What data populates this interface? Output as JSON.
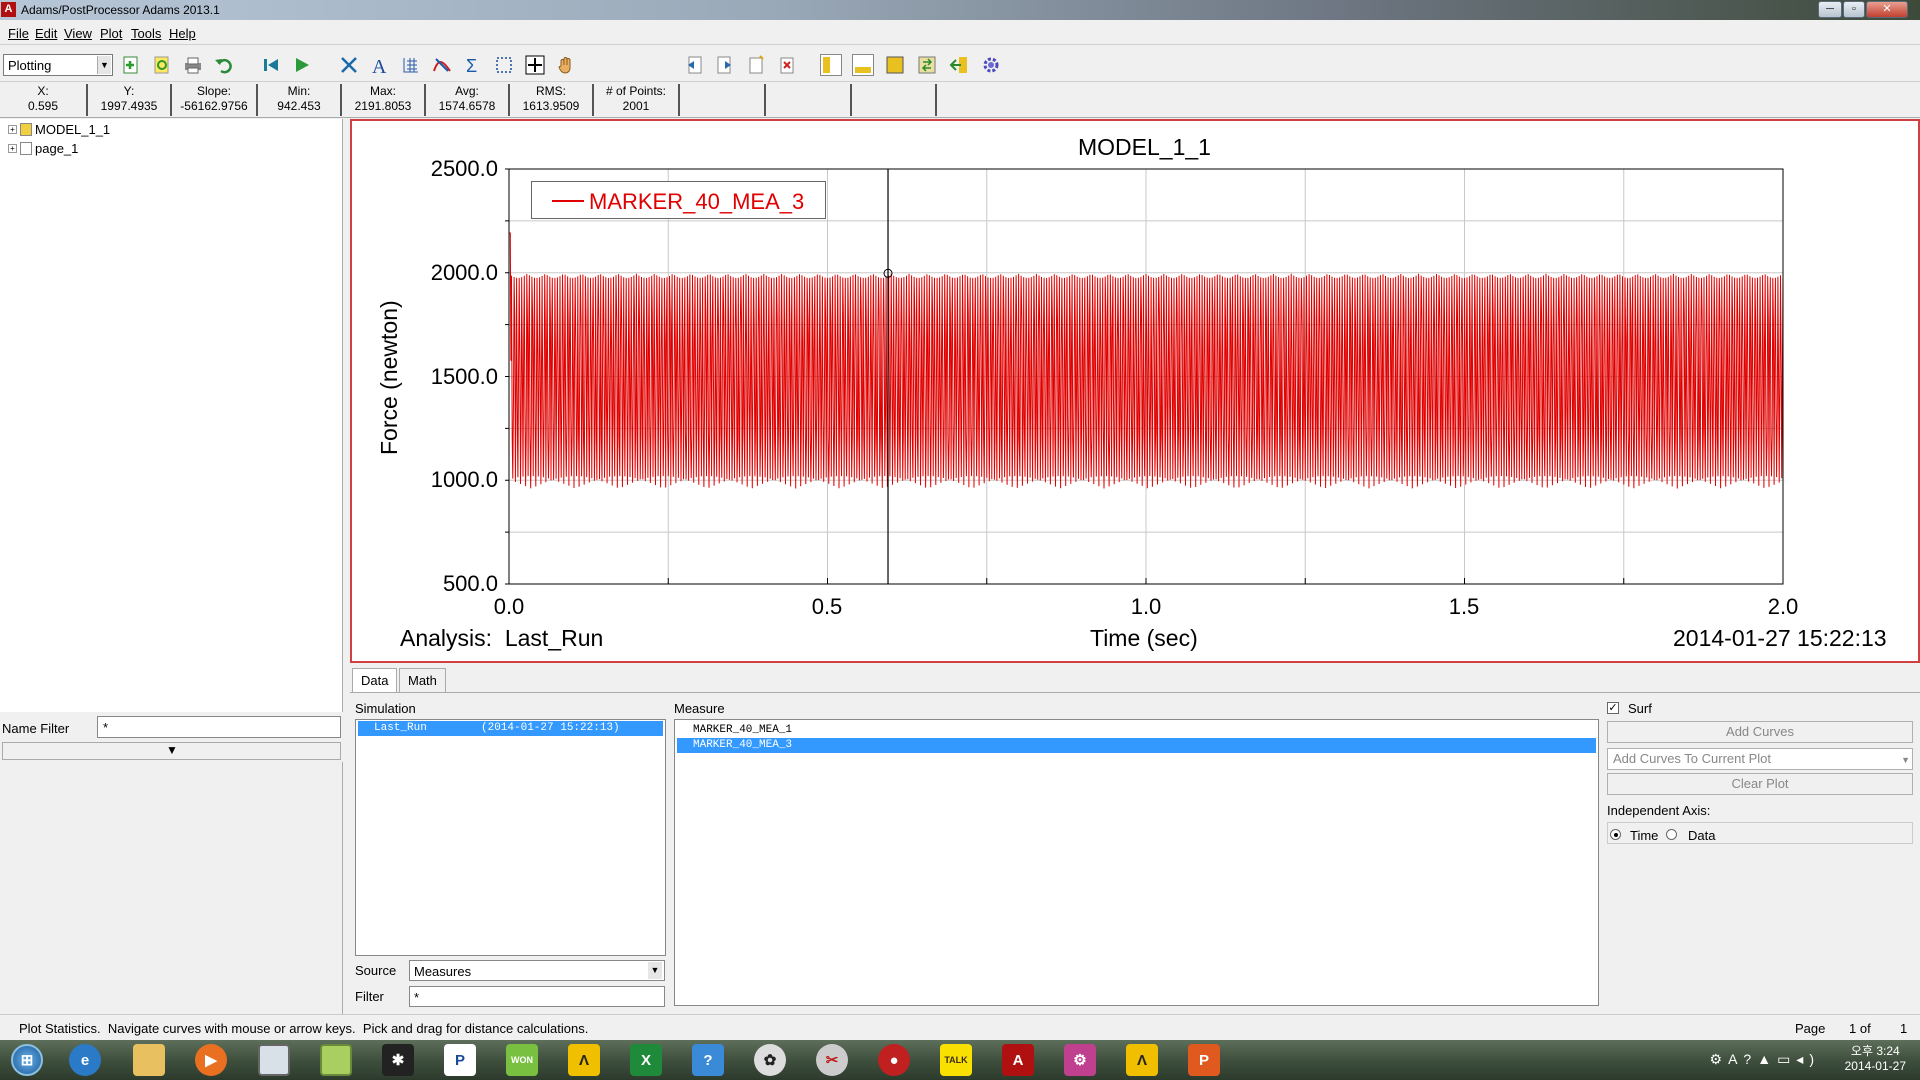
{
  "window": {
    "title": "Adams/PostProcessor Adams 2013.1",
    "app_icon": "A"
  },
  "menu": [
    "File",
    "Edit",
    "View",
    "Plot",
    "Tools",
    "Help"
  ],
  "toolbar": {
    "mode": "Plotting"
  },
  "stats": [
    {
      "label": "X:",
      "value": "0.595"
    },
    {
      "label": "Y:",
      "value": "1997.4935"
    },
    {
      "label": "Slope:",
      "value": "-56162.9756"
    },
    {
      "label": "Min:",
      "value": "942.453"
    },
    {
      "label": "Max:",
      "value": "2191.8053"
    },
    {
      "label": "Avg:",
      "value": "1574.6578"
    },
    {
      "label": "RMS:",
      "value": "1613.9509"
    },
    {
      "label": "# of Points:",
      "value": "2001"
    }
  ],
  "tree": [
    {
      "label": "MODEL_1_1"
    },
    {
      "label": "page_1"
    }
  ],
  "name_filter": {
    "label": "Name Filter",
    "value": "*"
  },
  "chart_data": {
    "type": "line",
    "title": "MODEL_1_1",
    "xlabel": "Time (sec)",
    "ylabel": "Force (newton)",
    "xlim": [
      0.0,
      2.0
    ],
    "ylim": [
      500.0,
      2500.0
    ],
    "x_ticks": [
      "0.0",
      "0.5",
      "1.0",
      "1.5",
      "2.0"
    ],
    "y_ticks": [
      "2500.0",
      "2000.0",
      "1500.0",
      "1000.0",
      "500.0"
    ],
    "grid": true,
    "legend": "top-left",
    "cursor_x": 0.595,
    "series": [
      {
        "name": "MARKER_40_MEA_3",
        "color": "#e00000",
        "min": 942.453,
        "max": 2191.8053,
        "avg": 1574.6578,
        "points": 2001
      }
    ],
    "analysis_label": "Analysis:  Last_Run",
    "date": "2014-01-27 15:22:13"
  },
  "tabs": [
    "Data",
    "Math"
  ],
  "simulation": {
    "label": "Simulation",
    "items": [
      {
        "name": "Last_Run",
        "date": "(2014-01-27 15:22:13)",
        "selected": true
      }
    ]
  },
  "measure": {
    "label": "Measure",
    "items": [
      {
        "name": "MARKER_40_MEA_1",
        "selected": false
      },
      {
        "name": "MARKER_40_MEA_3",
        "selected": true
      }
    ]
  },
  "source": {
    "label": "Source",
    "value": "Measures"
  },
  "filter": {
    "label": "Filter",
    "value": "*"
  },
  "controls": {
    "surf_label": "Surf",
    "add_curves": "Add Curves",
    "add_curves_plot": "Add Curves To Current Plot",
    "clear_plot": "Clear Plot",
    "indep_axis": "Independent Axis:",
    "time_label": "Time",
    "data_label": "Data"
  },
  "status": {
    "message": "Plot Statistics.  Navigate curves with mouse or arrow keys.  Pick and drag for distance calculations.",
    "page_label": "Page",
    "page_num": "1 of",
    "page_total": "1"
  },
  "clock": {
    "time": "오후 3:24",
    "date": "2014-01-27"
  },
  "taskbar": [
    "start",
    "ie",
    "explorer",
    "media",
    "app1",
    "app2",
    "app3",
    "app4",
    "app5",
    "app6",
    "excel",
    "app7",
    "app8",
    "app9",
    "app10",
    "kakaotalk",
    "acrobat",
    "app11",
    "adams",
    "powerpoint"
  ]
}
